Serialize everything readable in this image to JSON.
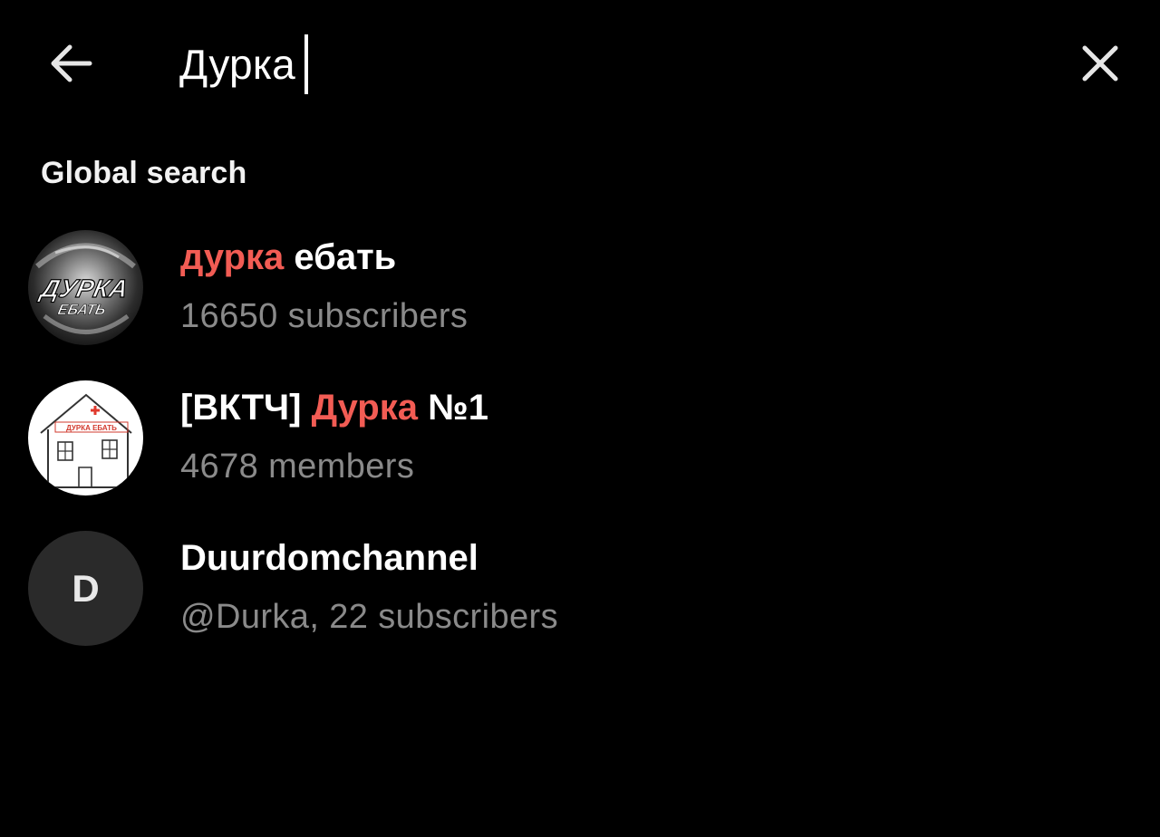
{
  "search": {
    "query": "Дурка"
  },
  "section": {
    "title": "Global search"
  },
  "results": [
    {
      "title_highlight": "дурка",
      "title_rest": " ебать",
      "subtitle": "16650 subscribers",
      "avatar_text_line1": "ДУРКА",
      "avatar_text_line2": "ЕБАТЬ"
    },
    {
      "title_prefix": "[ВКТЧ] ",
      "title_highlight": "Дурка",
      "title_rest": " №1",
      "subtitle": "4678 members",
      "avatar_text": "ДУРКА ЕБАТЬ"
    },
    {
      "title": "Duurdomchannel",
      "subtitle": "@Durka, 22 subscribers",
      "avatar_letter": "D"
    }
  ],
  "icons": {
    "back": "arrow-left-icon",
    "close": "close-icon"
  },
  "colors": {
    "background": "#000000",
    "highlight": "#f25c54",
    "subtitle": "#8a8a8a",
    "letter_avatar_bg": "#2a2a2a"
  }
}
